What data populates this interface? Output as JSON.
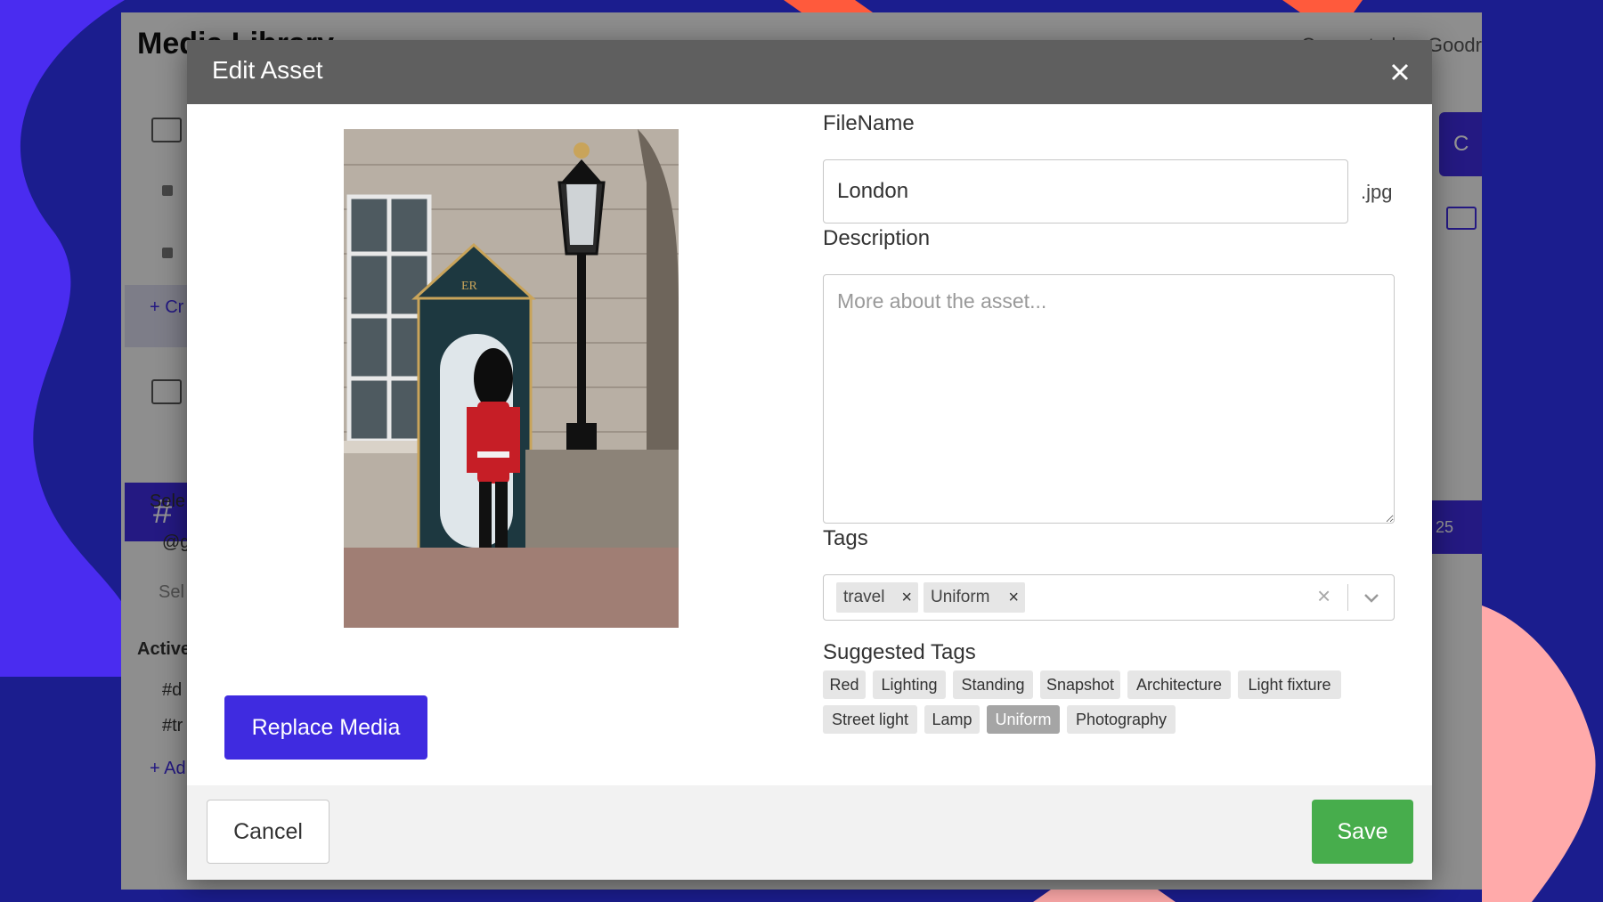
{
  "background_app": {
    "title": "Media Library",
    "user_text": "Connected as Goodr",
    "create_link": "+ Cr",
    "select_label": "Sele",
    "select_value": "@g",
    "select_hint": "Sel",
    "active_label": "Active",
    "active_item_1": "#d",
    "active_item_2": "#tr",
    "add_link": "+ Ad",
    "right_button": "C",
    "right_badge": "25"
  },
  "modal": {
    "title": "Edit Asset",
    "asset_photo": "Queen's Guard standing beside sentry box and street lamp",
    "replace_button": "Replace Media",
    "filename": {
      "label": "FileName",
      "value": "London",
      "extension": ".jpg"
    },
    "description": {
      "label": "Description",
      "placeholder": "More about the asset..."
    },
    "tags": {
      "label": "Tags",
      "selected": [
        "travel",
        "Uniform"
      ]
    },
    "suggested_tags": {
      "label": "Suggested Tags",
      "items": [
        "Red",
        "Lighting",
        "Standing",
        "Snapshot",
        "Architecture",
        "Light fixture",
        "Street light",
        "Lamp",
        "Uniform",
        "Photography"
      ],
      "highlighted": "Uniform"
    },
    "footer": {
      "cancel_label": "Cancel",
      "save_label": "Save"
    }
  },
  "colors": {
    "accent": "#3f2be0",
    "save": "#47ad4c",
    "header": "#5f5f5f"
  }
}
